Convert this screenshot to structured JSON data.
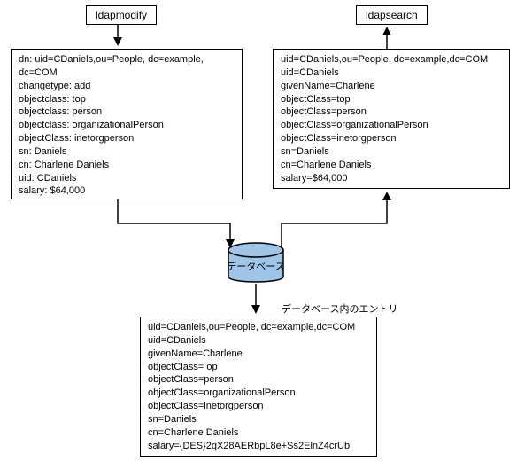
{
  "labels": {
    "ldapmodify": "ldapmodify",
    "ldapsearch": "ldapsearch",
    "database": "データベース",
    "db_entry": "データベース内のエントリ"
  },
  "ldapmodify_box": [
    "dn: uid=CDaniels,ou=People, dc=example,",
    "dc=COM",
    "changetype: add",
    "objectclass: top",
    "objectclass: person",
    "objectclass: organizationalPerson",
    "objectClass: inetorgperson",
    "sn: Daniels",
    "cn: Charlene Daniels",
    "uid: CDaniels",
    "salary: $64,000"
  ],
  "ldapsearch_box": [
    "uid=CDaniels,ou=People, dc=example,dc=COM",
    "uid=CDaniels",
    "givenName=Charlene",
    "objectClass=top",
    "objectClass=person",
    "objectClass=organizationalPerson",
    "objectClass=inetorgperson",
    "sn=Daniels",
    "cn=Charlene Daniels",
    "salary=$64,000"
  ],
  "db_box": [
    "uid=CDaniels,ou=People, dc=example,dc=COM",
    "uid=CDaniels",
    "givenName=Charlene",
    "objectClass= op",
    "objectClass=person",
    "objectClass=organizationalPerson",
    "objectClass=inetorgperson",
    "sn=Daniels",
    "cn=Charlene Daniels",
    "salary={DES}2qX28AERbpL8e+Ss2ElnZ4crUb"
  ]
}
